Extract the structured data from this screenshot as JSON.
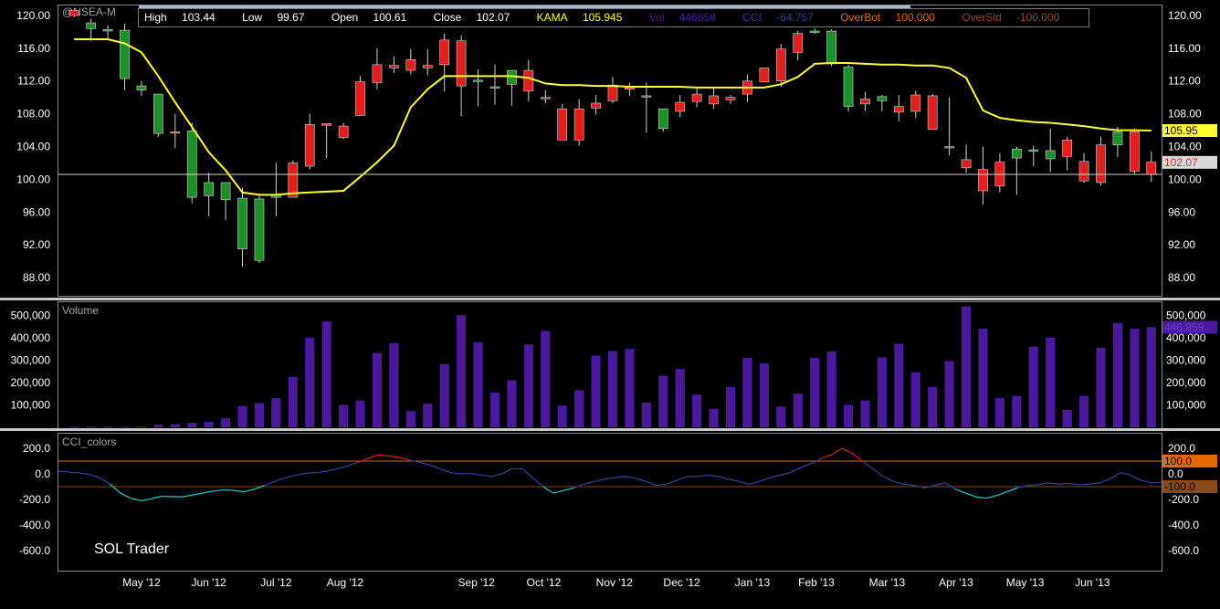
{
  "symbol": "@NSEA-M",
  "info": {
    "high_label": "High",
    "high_value": "103.44",
    "low_label": "Low",
    "low_value": "99.67",
    "open_label": "Open",
    "open_value": "100.61",
    "close_label": "Close",
    "close_value": "102.07",
    "kama_label": "KAMA",
    "kama_value": "105.945",
    "vol_label": "Vol",
    "vol_value": "446859",
    "cci_label": "CCI",
    "cci_value": "-64.757",
    "overbot_label": "OverBot",
    "overbot_value": "100.000",
    "oversld_label": "OverSld",
    "oversld_value": "-100.000"
  },
  "panels": {
    "volume_title": "Volume",
    "cci_title": "CCI_colors"
  },
  "watermark": "SOL Trader",
  "colors": {
    "background": "#000000",
    "up_candle": "#1f8f2a",
    "down_candle": "#e0201e",
    "kama_line": "#ffff33",
    "volume_bar": "#4b1a9c",
    "cci_low": "#2e3f8f",
    "cci_high": "#c8201e",
    "cci_oversold": "#1fbfbf",
    "overbot_line": "#e06a00",
    "oversld_line": "#8a4a1a"
  },
  "chart_data": {
    "type": "candlestick",
    "price_axis": {
      "range": [
        86,
        121
      ],
      "ticks": [
        "120.00",
        "116.00",
        "112.00",
        "108.00",
        "104.00",
        "100.00",
        "96.00",
        "92.00",
        "88.00"
      ]
    },
    "volume_axis": {
      "range": [
        0,
        550000
      ],
      "ticks": [
        "500,000",
        "400,000",
        "300,000",
        "200,000",
        "100,000"
      ]
    },
    "cci_axis": {
      "range": [
        -750,
        300
      ],
      "ticks": [
        "200.0",
        "0.0",
        "-200.0",
        "-400.0",
        "-600.0"
      ]
    },
    "x_labels": [
      "May '12",
      "Jun '12",
      "Jul '12",
      "Aug '12",
      "Sep '12",
      "Oct '12",
      "Nov '12",
      "Dec '12",
      "Jan '13",
      "Feb '13",
      "Mar '13",
      "Apr '13",
      "May '13",
      "Jun '13"
    ],
    "x_label_positions": [
      4.5,
      8.5,
      12.5,
      16.6,
      24.4,
      28.4,
      32.6,
      36.6,
      40.8,
      44.6,
      48.8,
      52.9,
      57.0,
      61.0
    ],
    "last_values": {
      "kama": "105.95",
      "close": "102.07",
      "volume": "446,859",
      "overbot": "100.0",
      "oversld": "-100.0"
    },
    "ohlc": [
      [
        120.6,
        120.6,
        119.8,
        120.0
      ],
      [
        118.4,
        119.6,
        116.9,
        119.1
      ],
      [
        118.1,
        118.8,
        117.1,
        118.3
      ],
      [
        112.3,
        119.0,
        110.9,
        118.2
      ],
      [
        110.9,
        112.0,
        110.2,
        111.4
      ],
      [
        105.6,
        110.4,
        105.2,
        110.4
      ],
      [
        105.8,
        108.0,
        103.8,
        105.7
      ],
      [
        97.8,
        106.9,
        97.1,
        105.9
      ],
      [
        98.0,
        100.8,
        95.5,
        99.6
      ],
      [
        97.5,
        99.6,
        95.0,
        99.6
      ],
      [
        91.5,
        99.0,
        89.3,
        97.7
      ],
      [
        90.1,
        98.2,
        89.8,
        97.6
      ],
      [
        97.8,
        102.0,
        95.5,
        98.1
      ],
      [
        102.0,
        102.3,
        97.8,
        97.8
      ],
      [
        106.7,
        108.0,
        101.2,
        101.6
      ],
      [
        106.8,
        106.8,
        102.6,
        106.6
      ],
      [
        106.5,
        106.9,
        104.9,
        105.1
      ],
      [
        111.9,
        112.6,
        107.8,
        107.8
      ],
      [
        114.0,
        116.0,
        111.0,
        111.8
      ],
      [
        113.9,
        115.0,
        113.0,
        113.6
      ],
      [
        114.6,
        115.9,
        112.8,
        113.3
      ],
      [
        113.9,
        115.9,
        112.7,
        113.6
      ],
      [
        117.0,
        117.8,
        110.7,
        114.0
      ],
      [
        116.9,
        117.6,
        107.7,
        111.4
      ],
      [
        112.1,
        113.4,
        108.9,
        112.1
      ],
      [
        111.3,
        114.0,
        109.1,
        111.3
      ],
      [
        111.6,
        113.2,
        109.0,
        113.3
      ],
      [
        113.3,
        114.6,
        109.5,
        110.8
      ],
      [
        110.0,
        110.9,
        109.3,
        110.0
      ],
      [
        108.6,
        109.2,
        104.8,
        104.8
      ],
      [
        108.6,
        109.8,
        104.1,
        104.8
      ],
      [
        109.3,
        110.3,
        107.9,
        108.7
      ],
      [
        111.5,
        112.5,
        109.3,
        109.6
      ],
      [
        111.2,
        111.8,
        110.2,
        111.0
      ],
      [
        110.2,
        111.8,
        105.7,
        110.2
      ],
      [
        106.2,
        108.6,
        105.8,
        108.6
      ],
      [
        109.4,
        110.3,
        107.6,
        108.3
      ],
      [
        110.4,
        111.3,
        108.8,
        109.5
      ],
      [
        110.2,
        111.3,
        108.6,
        109.2
      ],
      [
        110.0,
        110.3,
        109.2,
        109.7
      ],
      [
        112.0,
        112.8,
        109.4,
        110.4
      ],
      [
        113.6,
        113.6,
        111.8,
        111.9
      ],
      [
        115.9,
        116.5,
        111.3,
        112.0
      ],
      [
        117.8,
        118.1,
        114.5,
        115.5
      ],
      [
        118.0,
        118.4,
        117.8,
        118.1
      ],
      [
        114.1,
        118.3,
        113.8,
        118.1
      ],
      [
        108.9,
        114.0,
        108.3,
        113.7
      ],
      [
        109.8,
        110.7,
        108.4,
        109.2
      ],
      [
        109.6,
        110.3,
        108.3,
        110.1
      ],
      [
        108.9,
        110.3,
        107.1,
        108.2
      ],
      [
        110.3,
        110.8,
        107.5,
        108.3
      ],
      [
        110.2,
        110.4,
        106.5,
        106.1
      ],
      [
        104.0,
        110.0,
        102.9,
        104.0
      ],
      [
        102.4,
        104.2,
        100.8,
        101.4
      ],
      [
        101.2,
        104.0,
        96.9,
        98.6
      ],
      [
        102.1,
        103.2,
        98.4,
        99.2
      ],
      [
        102.6,
        104.0,
        98.1,
        103.7
      ],
      [
        103.5,
        104.1,
        101.6,
        103.6
      ],
      [
        102.5,
        106.2,
        100.9,
        103.5
      ],
      [
        104.8,
        105.2,
        101.1,
        102.8
      ],
      [
        102.2,
        103.2,
        99.6,
        99.8
      ],
      [
        104.2,
        105.2,
        99.2,
        99.6
      ],
      [
        104.2,
        106.4,
        102.7,
        105.8
      ],
      [
        105.8,
        106.2,
        100.6,
        101.0
      ],
      [
        102.1,
        103.4,
        99.7,
        100.6
      ]
    ],
    "kama": [
      117.1,
      117.1,
      117.1,
      116.6,
      115.5,
      112.6,
      109.4,
      106.4,
      103.3,
      101.1,
      98.4,
      98.1,
      98.1,
      98.3,
      98.4,
      98.5,
      98.6,
      100.3,
      102.1,
      104.1,
      108.8,
      111.0,
      112.6,
      112.6,
      112.6,
      112.6,
      112.6,
      112.4,
      111.7,
      111.5,
      111.5,
      111.4,
      111.4,
      111.3,
      111.3,
      111.3,
      111.3,
      111.2,
      111.2,
      111.2,
      111.2,
      111.2,
      111.6,
      112.5,
      114.1,
      114.2,
      114.2,
      114.1,
      114.0,
      114.0,
      113.9,
      113.9,
      113.6,
      112.4,
      108.4,
      107.5,
      107.2,
      107.0,
      106.9,
      106.7,
      106.5,
      106.2,
      106.0,
      106.0,
      105.95
    ],
    "volume": [
      2000,
      3000,
      3000,
      3000,
      4000,
      12000,
      14000,
      20000,
      25000,
      40000,
      95000,
      108000,
      130000,
      225000,
      400000,
      473000,
      100000,
      120000,
      332000,
      375000,
      72000,
      105000,
      282000,
      500000,
      380000,
      155000,
      210000,
      370000,
      430000,
      97000,
      165000,
      320000,
      340000,
      350000,
      110000,
      230000,
      260000,
      145000,
      83000,
      180000,
      310000,
      285000,
      92000,
      150000,
      310000,
      338000,
      100000,
      120000,
      312000,
      373000,
      245000,
      180000,
      295000,
      540000,
      440000,
      130000,
      140000,
      360000,
      400000,
      78000,
      140000,
      355000,
      465000,
      440000,
      446859
    ],
    "cci": [
      20,
      15,
      8,
      -5,
      -30,
      -80,
      -150,
      -190,
      -210,
      -195,
      -175,
      -178,
      -180,
      -165,
      -150,
      -135,
      -125,
      -130,
      -140,
      -120,
      -90,
      -60,
      -30,
      -10,
      5,
      10,
      20,
      40,
      60,
      90,
      120,
      150,
      140,
      130,
      110,
      90,
      70,
      40,
      10,
      0,
      5,
      -10,
      -20,
      0,
      40,
      40,
      -30,
      -100,
      -150,
      -130,
      -110,
      -80,
      -60,
      -40,
      -30,
      -20,
      -35,
      -60,
      -90,
      -80,
      -50,
      -20,
      -20,
      -10,
      -20,
      -40,
      -60,
      -80,
      -60,
      -30,
      -10,
      10,
      50,
      80,
      120,
      150,
      200,
      160,
      100,
      40,
      -20,
      -60,
      -80,
      -90,
      -110,
      -90,
      -70,
      -120,
      -150,
      -180,
      -190,
      -170,
      -140,
      -110,
      -90,
      -85,
      -70,
      -80,
      -75,
      -85,
      -80,
      -70,
      -40,
      10,
      -10,
      -50,
      -70,
      -65
    ]
  }
}
